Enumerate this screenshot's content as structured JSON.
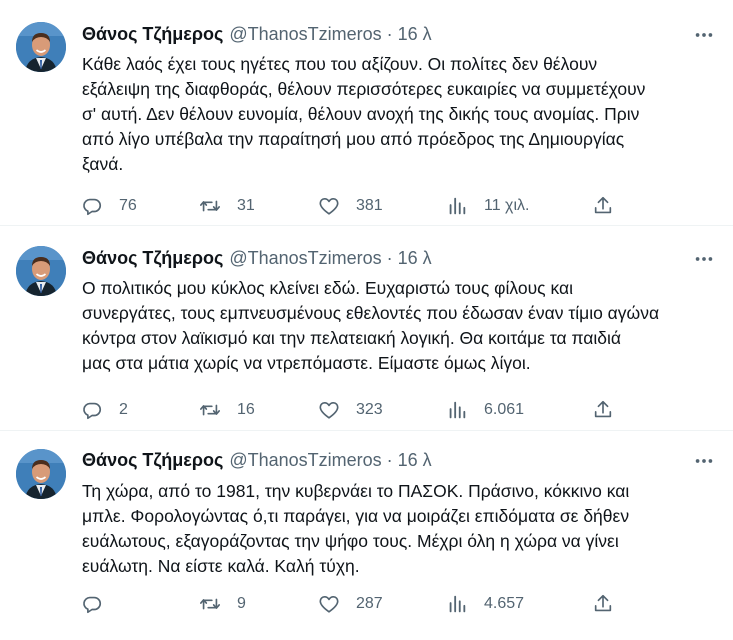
{
  "tweets": [
    {
      "author": {
        "display_name": "Θάνος Τζήμερος",
        "handle": "@ThanosTzimeros"
      },
      "separator": "·",
      "time": "16 λ",
      "text_lines": [
        "Κάθε λαός έχει τους ηγέτες που του αξίζουν. Οι πολίτες δεν θέλουν",
        "εξάλειψη της διαφθοράς, θέλουν περισσότερες ευκαιρίες να συμμετέχουν",
        "σ' αυτή. Δεν θέλουν ευνομία, θέλουν ανοχή της δικής τους ανομίας. Πριν",
        "από λίγο υπέβαλα την παραίτησή μου από πρόεδρος της Δημιουργίας",
        "ξανά."
      ],
      "stats": {
        "replies": "76",
        "retweets": "31",
        "likes": "381",
        "views": "11 χιλ."
      }
    },
    {
      "author": {
        "display_name": "Θάνος Τζήμερος",
        "handle": "@ThanosTzimeros"
      },
      "separator": "·",
      "time": "16 λ",
      "text_lines": [
        "Ο πολιτικός μου κύκλος κλείνει εδώ. Ευχαριστώ τους φίλους και",
        "συνεργάτες, τους εμπνευσμένους εθελοντές που έδωσαν έναν τίμιο αγώνα",
        "κόντρα στον λαϊκισμό και την πελατειακή λογική. Θα κοιτάμε τα παιδιά",
        "μας στα μάτια χωρίς να ντρεπόμαστε. Είμαστε όμως λίγοι."
      ],
      "stats": {
        "replies": "2",
        "retweets": "16",
        "likes": "323",
        "views": "6.061"
      }
    },
    {
      "author": {
        "display_name": "Θάνος Τζήμερος",
        "handle": "@ThanosTzimeros"
      },
      "separator": "·",
      "time": "16 λ",
      "text_lines": [
        "Τη χώρα, από το 1981, την κυβερνάει το ΠΑΣΟΚ. Πράσινο, κόκκινο και",
        "μπλε. Φορολογώντας ό,τι παράγει, για να μοιράζει επιδόματα σε δήθεν",
        "ευάλωτους, εξαγοράζοντας την ψήφο τους. Μέχρι όλη η χώρα να γίνει",
        "ευάλωτη. Να είστε καλά. Καλή τύχη."
      ],
      "stats": {
        "replies": "",
        "retweets": "9",
        "likes": "287",
        "views": "4.657"
      }
    }
  ],
  "icons": {
    "reply": "reply-icon",
    "retweet": "retweet-icon",
    "like": "like-icon",
    "views": "views-icon",
    "share": "share-icon",
    "more": "more-icon"
  },
  "colors": {
    "text": "#0f1419",
    "muted": "#536471",
    "separator": "#eff3f4",
    "avatar_bg": "#3f7fb9"
  }
}
